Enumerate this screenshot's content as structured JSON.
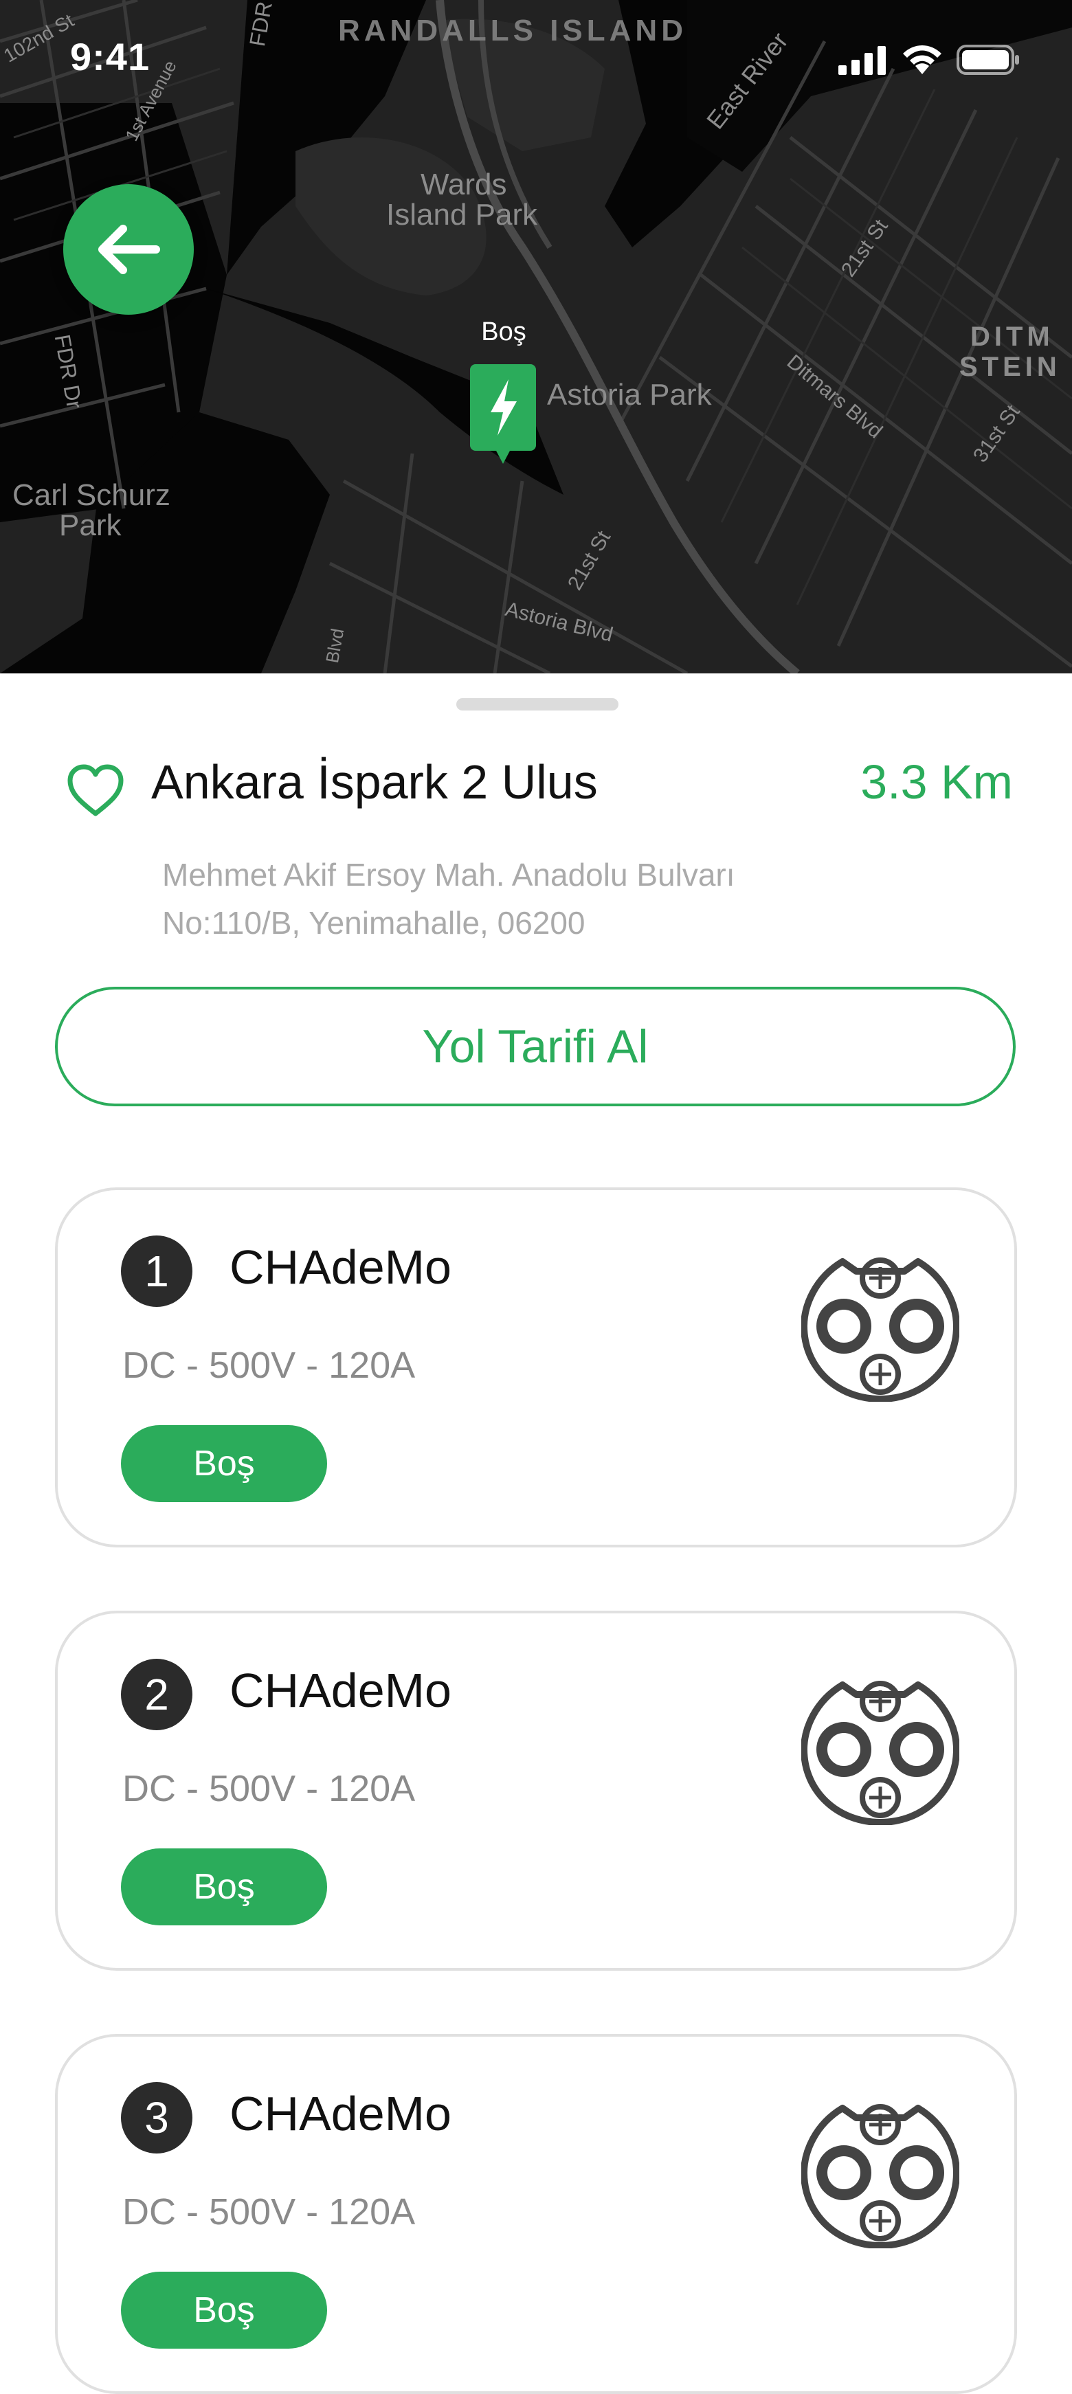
{
  "status_bar": {
    "time": "9:41"
  },
  "map": {
    "labels": {
      "randalls": "RANDALLS ISLAND",
      "wards": "Wards",
      "wards2": "Island Park",
      "astoria_park": "Astoria Park",
      "carl1": "Carl Schurz",
      "carl2": "Park",
      "east_river": "East River",
      "ditmars": "Ditmars Blvd",
      "ditm": "DITM",
      "stein": "STEIN",
      "st21a": "21st St",
      "st21b": "21st St",
      "st31": "31st St",
      "fdr": "FDR Dr",
      "fdr2": "FDR",
      "first_ave": "1st Avenue",
      "second": "102nd St",
      "astoria_blvd": "Astoria Blvd",
      "blvd": "Blvd"
    },
    "pin_label": "Boş"
  },
  "station": {
    "name": "Ankara İspark 2 Ulus",
    "distance": "3.3 Km",
    "address_line1": "Mehmet Akif Ersoy Mah. Anadolu Bulvarı",
    "address_line2": "No:110/B, Yenimahalle, 06200",
    "route_button": "Yol Tarifi Al"
  },
  "connectors": [
    {
      "number": "1",
      "name": "CHAdeMo",
      "spec": "DC - 500V - 120A",
      "status": "Boş"
    },
    {
      "number": "2",
      "name": "CHAdeMo",
      "spec": "DC - 500V - 120A",
      "status": "Boş"
    },
    {
      "number": "3",
      "name": "CHAdeMo",
      "spec": "DC - 500V - 120A",
      "status": "Boş"
    }
  ],
  "colors": {
    "accent": "#2bac5b",
    "map_bg": "#1f1f1f",
    "water": "#000000"
  }
}
